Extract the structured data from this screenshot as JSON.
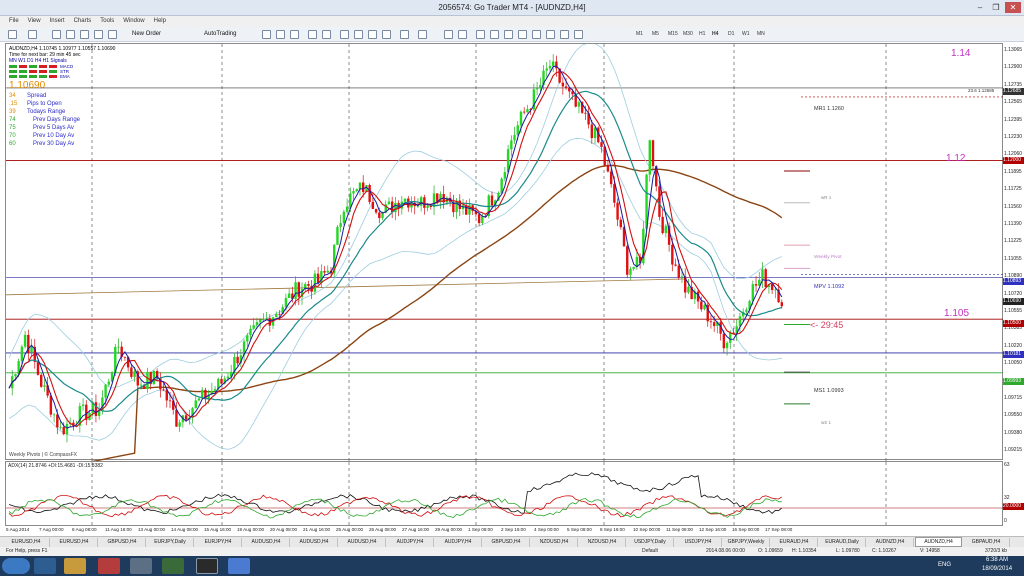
{
  "window": {
    "title": "2056574: Go Trader MT4 - [AUDNZD,H4]",
    "min": "–",
    "max": "❐",
    "close": "✕"
  },
  "menu": [
    "File",
    "View",
    "Insert",
    "Charts",
    "Tools",
    "Window",
    "Help"
  ],
  "toolbar": {
    "new_order": "New Order",
    "autotrading": "AutoTrading",
    "timeframes": [
      "M1",
      "M5",
      "M15",
      "M30",
      "H1",
      "H4",
      "D1",
      "W1",
      "MN"
    ]
  },
  "chart": {
    "header": "AUDNZD,H4  1.10745 1.10977 1.10557 1.10690",
    "next_bar": "Time for next bar: 29 min 45 sec",
    "tf_row": "MN  W1  D1  H4  H1  Signals",
    "signal_rows": [
      "MACD",
      "STR",
      "EMA"
    ],
    "price": "1.10690",
    "stats": [
      {
        "value": "34",
        "label": "Spread"
      },
      {
        "value": ".15",
        "label": "Pips to Open"
      },
      {
        "value": "39",
        "label": "Todays Range"
      },
      {
        "value": "74",
        "label": "Prev Days Range"
      },
      {
        "value": "75",
        "label": "Prev 5 Days Av"
      },
      {
        "value": "70",
        "label": "Prev 10 Day Av"
      },
      {
        "value": "60",
        "label": "Prev 30 Day Av"
      }
    ],
    "round_labels": [
      "1.14",
      "1.12",
      "1.105"
    ],
    "pivots": {
      "mr1": "MR1   1.1260",
      "wr1": "wR 1",
      "weekly_pivot": "Weekly Pivot",
      "mpv": "MPV    1.1092",
      "ms1": "MS1   1.0993",
      "ws1": "wS 1"
    },
    "line_label": "23.6   1.12685",
    "countdown": "<- 29:45",
    "footer": "Weekly Pivots | © CompassFX"
  },
  "indicator": {
    "label": "ADX(14) 21.8746  +DI:15.4681  -DI:15.8382",
    "scale": [
      "63",
      "32",
      "20.0000",
      "0"
    ]
  },
  "price_scale": [
    "1.13065",
    "1.12900",
    "1.12735",
    "1.12565",
    "1.12395",
    "1.12230",
    "1.12060",
    "1.11895",
    "1.11725",
    "1.11560",
    "1.11390",
    "1.11225",
    "1.11055",
    "1.10890",
    "1.10720",
    "1.10555",
    "1.10385",
    "1.10220",
    "1.10050",
    "1.09885",
    "1.09715",
    "1.09550",
    "1.09380",
    "1.09215"
  ],
  "price_tags": [
    {
      "text": "1.12685",
      "color": "#333333"
    },
    {
      "text": "1.12000",
      "color": "#b00000"
    },
    {
      "text": "1.10893",
      "color": "#3030c0"
    },
    {
      "text": "1.10690",
      "color": "#222222"
    },
    {
      "text": "1.10500",
      "color": "#b00000"
    },
    {
      "text": "1.10181",
      "color": "#3030c0"
    },
    {
      "text": "1.09993",
      "color": "#2fa82f"
    }
  ],
  "time_axis": [
    "5 Aug 2014",
    "7 Aug 00:00",
    "8 Aug 08:00",
    "11 Aug 16:00",
    "13 Aug 00:00",
    "14 Aug 08:00",
    "15 Aug 16:00",
    "19 Aug 00:00",
    "20 Aug 08:00",
    "21 Aug 16:00",
    "25 Aug 00:00",
    "26 Aug 08:00",
    "27 Aug 16:00",
    "29 Aug 00:00",
    "1 Sep 08:00",
    "2 Sep 16:00",
    "4 Sep 00:00",
    "5 Sep 08:00",
    "8 Sep 16:00",
    "10 Sep 00:00",
    "11 Sep 08:00",
    "12 Sep 16:00",
    "16 Sep 00:00",
    "17 Sep 08:00"
  ],
  "tabs": [
    "EURUSD,H4",
    "EURUSD,H4",
    "GBPUSD,H4",
    "EURJPY,Daily",
    "EURJPY,H4",
    "AUDUSD,H4",
    "AUDUSD,H4",
    "AUDUSD,H4",
    "AUDJPY,H4",
    "AUDJPY,H4",
    "GBPUSD,H4",
    "NZDUSD,H4",
    "NZDUSD,H4",
    "USDJPY,Daily",
    "USDJPY,H4",
    "GBPJPY,Weekly",
    "EURAUD,H4",
    "EURAUD,Daily",
    "AUDNZD,H4",
    "AUDNZD,H4",
    "GBPAUD,H4"
  ],
  "active_tab_index": 19,
  "status": {
    "help": "For Help, press F1",
    "profile": "Default",
    "datetime": "2014.08.06 00:00",
    "open": "O: 1.09659",
    "high": "H: 1.10354",
    "low": "L: 1.09780",
    "close": "C: 1.10267",
    "volume": "V: 14958",
    "traffic": "3720/3 kb"
  },
  "taskbar": {
    "lang": "ENG",
    "time": "6:38 AM",
    "date": "18/09/2014"
  }
}
